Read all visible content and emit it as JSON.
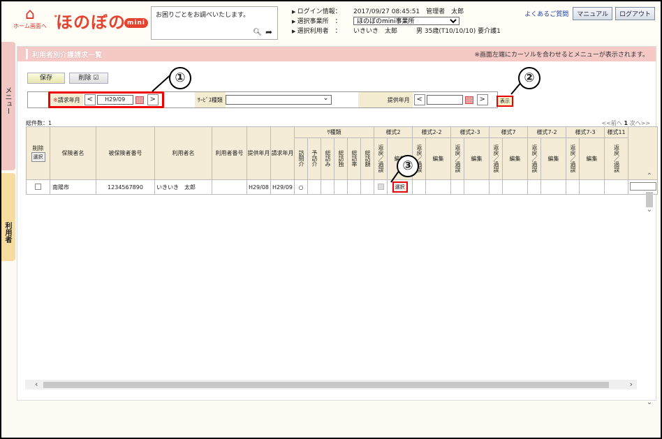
{
  "header": {
    "home_label": "ホーム画面へ",
    "logo_text": "ほのぼの",
    "logo_badge": "mini",
    "help_text": "お困りごとをお調べいたします。",
    "info": [
      {
        "key": "ログイン情報：",
        "value": "2017/09/27 08:45:51　管理者　太郎"
      },
      {
        "key": "選択事業所　：",
        "value": "ほのぼのmini事業所"
      },
      {
        "key": "選択利用者　：",
        "value": "いきいき　太郎　　　男 35歳(T10/10/10) 要介護1"
      }
    ],
    "faq_label": "よくあるご質問",
    "manual_label": "マニュアル",
    "logout_label": "ログアウト"
  },
  "side": {
    "menu_label": "メニュー",
    "user_label": "利用者"
  },
  "page": {
    "title": "利用者別介護請求一覧",
    "note": "※画面左端にカーソルを合わせるとメニューが表示されます。",
    "save_label": "保存",
    "delete_label": "削除 ☑",
    "filter": {
      "claim_label": "請求年月",
      "claim_required": "※",
      "claim_value": "H29/09",
      "service_label": "ｻｰﾋﾞｽ種類",
      "provide_label": "提供年月",
      "provide_value": ""
    },
    "show_label": "表示",
    "total_label": "総件数：1",
    "pager_prev": "<<前へ",
    "pager_page": "1",
    "pager_next": "次へ>>"
  },
  "callouts": [
    "①",
    "②",
    "③"
  ],
  "table": {
    "headers": {
      "delete": "削除",
      "select": "選択",
      "insurer": "保険者名",
      "insured_no": "被保険者番号",
      "user_name": "利用者名",
      "user_no": "利用者番号",
      "provide": "提供年月",
      "claim": "請求年月",
      "type_group": "ｻ種類",
      "types": [
        "訪問介",
        "予訪介",
        "総訪み",
        "総訪独",
        "総訪率",
        "総訪額"
      ],
      "styles": [
        "様式2",
        "様式2-2",
        "様式2-3",
        "様式7",
        "様式7-2",
        "様式7-3",
        "様式11"
      ],
      "return_label": "返戻／過誤",
      "edit_label": "編集"
    },
    "row": {
      "insurer": "南陽市",
      "insured_no": "1234567890",
      "user_name": "いきいき　太郎",
      "user_no": "",
      "provide": "H29/08",
      "claim": "H29/09",
      "visit": "○",
      "select_label": "選択"
    }
  }
}
